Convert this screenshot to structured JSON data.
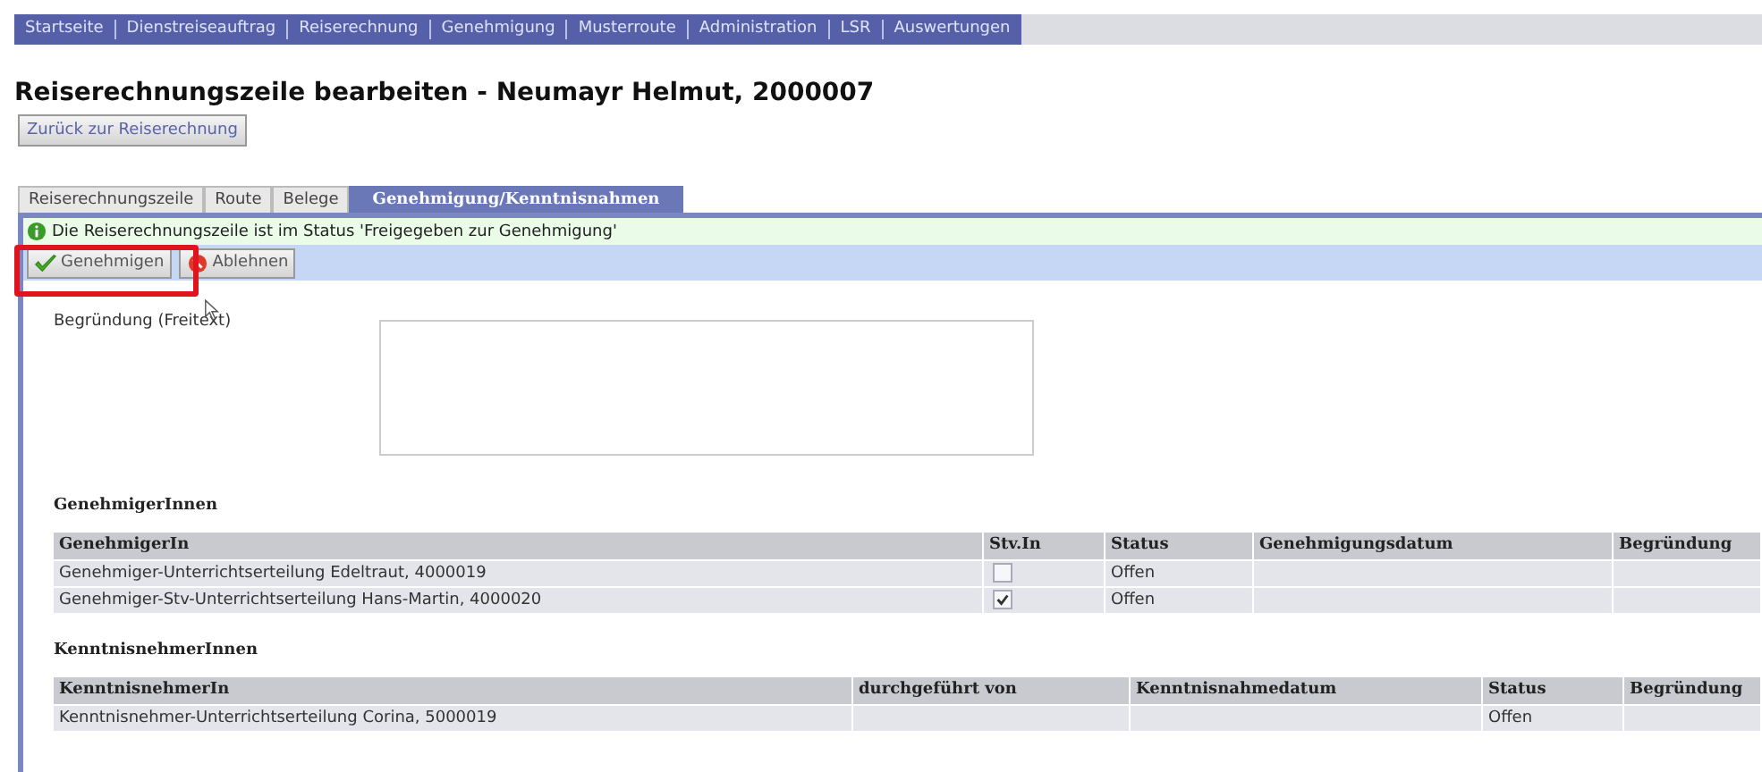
{
  "nav": [
    {
      "label": "Startseite"
    },
    {
      "label": "Dienstreiseauftrag"
    },
    {
      "label": "Reiserechnung"
    },
    {
      "label": "Genehmigung"
    },
    {
      "label": "Musterroute"
    },
    {
      "label": "Administration"
    },
    {
      "label": "LSR"
    },
    {
      "label": "Auswertungen"
    }
  ],
  "title": "Reiserechnungszeile bearbeiten - Neumayr Helmut, 2000007",
  "back_button": "Zurück zur Reiserechnung",
  "tabs": [
    {
      "label": "Reiserechnungszeile",
      "selected": false
    },
    {
      "label": "Route",
      "selected": false
    },
    {
      "label": "Belege",
      "selected": false
    },
    {
      "label": "Genehmigung/Kenntnisnahmen",
      "selected": true
    }
  ],
  "message": "Die Reiserechnungszeile ist im Status 'Freigegeben zur Genehmigung'",
  "actions": [
    {
      "label": "Genehmigen",
      "kind": "approve"
    },
    {
      "label": "Ablehnen",
      "kind": "reject"
    }
  ],
  "reason": {
    "label": "Begründung (Freitext)"
  },
  "tables": [
    {
      "heading": "GenehmigerInnen",
      "columns": [
        {
          "label": "GenehmigerIn",
          "kind": "name"
        },
        {
          "label": "Stv.In",
          "kind": "checkbox"
        },
        {
          "label": "Status",
          "kind": "status"
        },
        {
          "label": "Genehmigungsdatum",
          "kind": "blank"
        },
        {
          "label": "Begründung",
          "kind": "blank"
        }
      ],
      "rows": [
        {
          "name": "Genehmiger-Unterrichtserteilung Edeltraut, 4000019",
          "checked": false,
          "status": "Offen"
        },
        {
          "name": "Genehmiger-Stv-Unterrichtserteilung Hans-Martin, 4000020",
          "checked": true,
          "status": "Offen"
        }
      ]
    },
    {
      "heading": "KenntnisnehmerInnen",
      "columns": [
        {
          "label": "KenntnisnehmerIn",
          "kind": "name"
        },
        {
          "label": "durchgeführt von",
          "kind": "blank"
        },
        {
          "label": "Kenntnisnahmedatum",
          "kind": "blank"
        },
        {
          "label": "Status",
          "kind": "status"
        },
        {
          "label": "Begründung",
          "kind": "blank"
        }
      ],
      "rows": [
        {
          "name": "Kenntnisnehmer-Unterrichtserteilung Corina, 5000019",
          "status": "Offen"
        }
      ]
    }
  ]
}
